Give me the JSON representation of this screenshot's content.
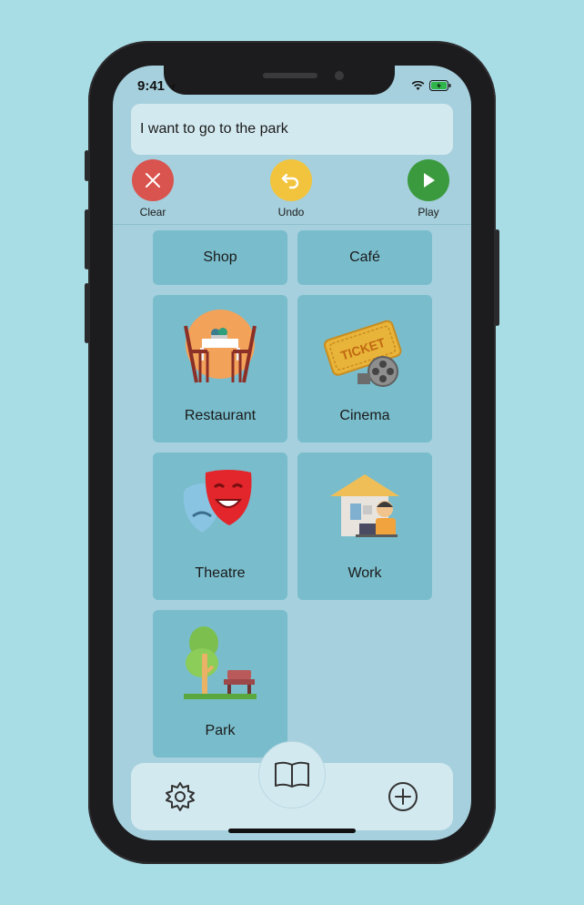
{
  "status": {
    "time": "9:41"
  },
  "sentence": {
    "text": "I want to go to the park"
  },
  "controls": {
    "clear": {
      "label": "Clear",
      "color": "#d9534f"
    },
    "undo": {
      "label": "Undo",
      "color": "#f2c43d"
    },
    "play": {
      "label": "Play",
      "color": "#3b9a3e"
    }
  },
  "tiles": [
    {
      "label": "Shop",
      "icon": "shop"
    },
    {
      "label": "Café",
      "icon": "cafe"
    },
    {
      "label": "Restaurant",
      "icon": "restaurant-icon"
    },
    {
      "label": "Cinema",
      "icon": "cinema-ticket-icon",
      "icon_text": "TICKET"
    },
    {
      "label": "Theatre",
      "icon": "theatre-masks-icon"
    },
    {
      "label": "Work",
      "icon": "work-icon"
    },
    {
      "label": "Park",
      "icon": "park-icon"
    }
  ],
  "bottom_bar": {
    "left_icon": "gear-icon",
    "center_icon": "book-icon",
    "right_icon": "plus-circle-icon"
  },
  "colors": {
    "background": "#a9dde6",
    "screen": "#a6d0dd",
    "tile": "#79bdcc"
  }
}
